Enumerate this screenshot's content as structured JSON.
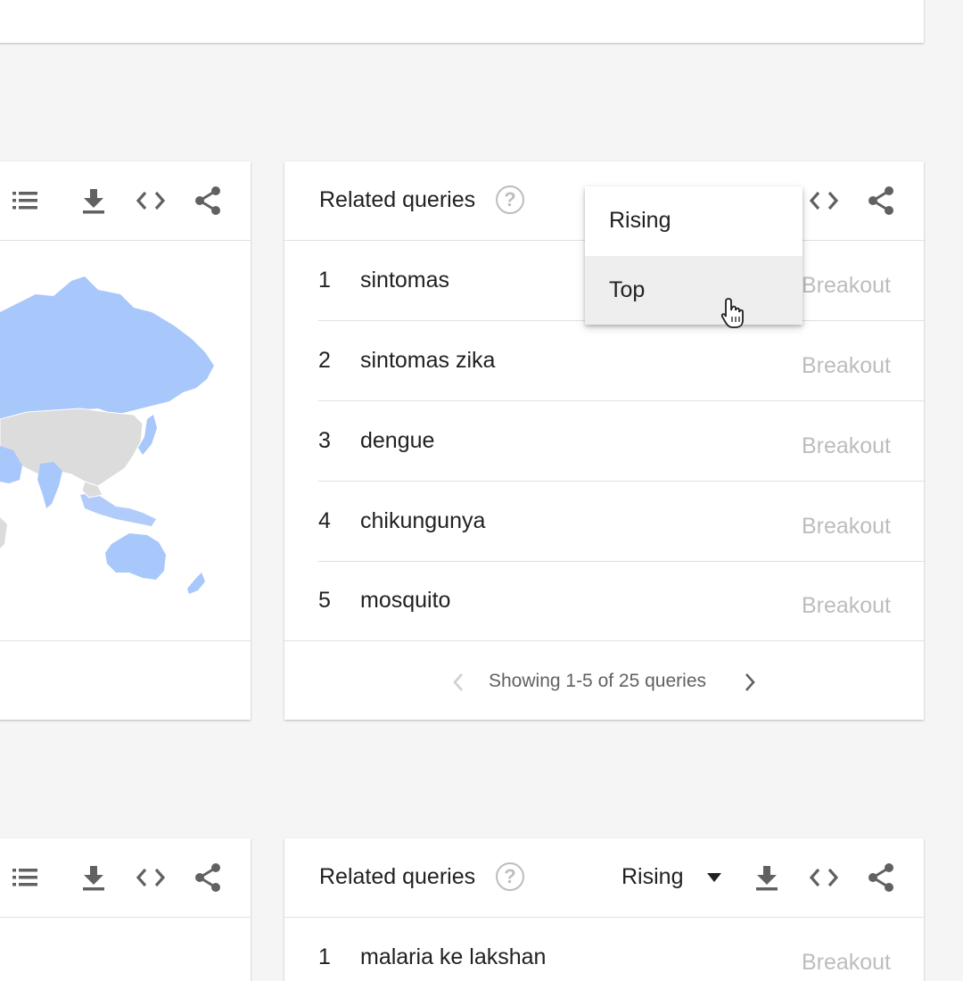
{
  "related_queries_card": {
    "title": "Related queries",
    "dropdown_options": [
      "Rising",
      "Top"
    ],
    "hovered_option": "Top",
    "rows": [
      {
        "rank": "1",
        "query": "sintomas",
        "value": "Breakout"
      },
      {
        "rank": "2",
        "query": "sintomas zika",
        "value": "Breakout"
      },
      {
        "rank": "3",
        "query": "dengue",
        "value": "Breakout"
      },
      {
        "rank": "4",
        "query": "chikungunya",
        "value": "Breakout"
      },
      {
        "rank": "5",
        "query": "mosquito",
        "value": "Breakout"
      }
    ],
    "pagination": "Showing 1-5 of 25 queries"
  },
  "second_related_queries_card": {
    "title": "Related queries",
    "dropdown_selected": "Rising",
    "rows": [
      {
        "rank": "1",
        "query": "malaria ke lakshan",
        "value": "Breakout"
      }
    ]
  },
  "icons": {
    "list": "list-icon",
    "download": "download-icon",
    "embed": "embed-icon",
    "share": "share-icon",
    "help": "help-icon",
    "dropdown": "dropdown-arrow-icon",
    "prev": "chevron-left-icon",
    "next": "chevron-right-icon",
    "cursor": "hand-pointer-icon"
  },
  "colors": {
    "background": "#f5f5f5",
    "map_highlight": "#a8c7fa",
    "map_neutral": "#dcdcdc",
    "muted_text": "#bdbdbd"
  },
  "help_glyph": "?"
}
